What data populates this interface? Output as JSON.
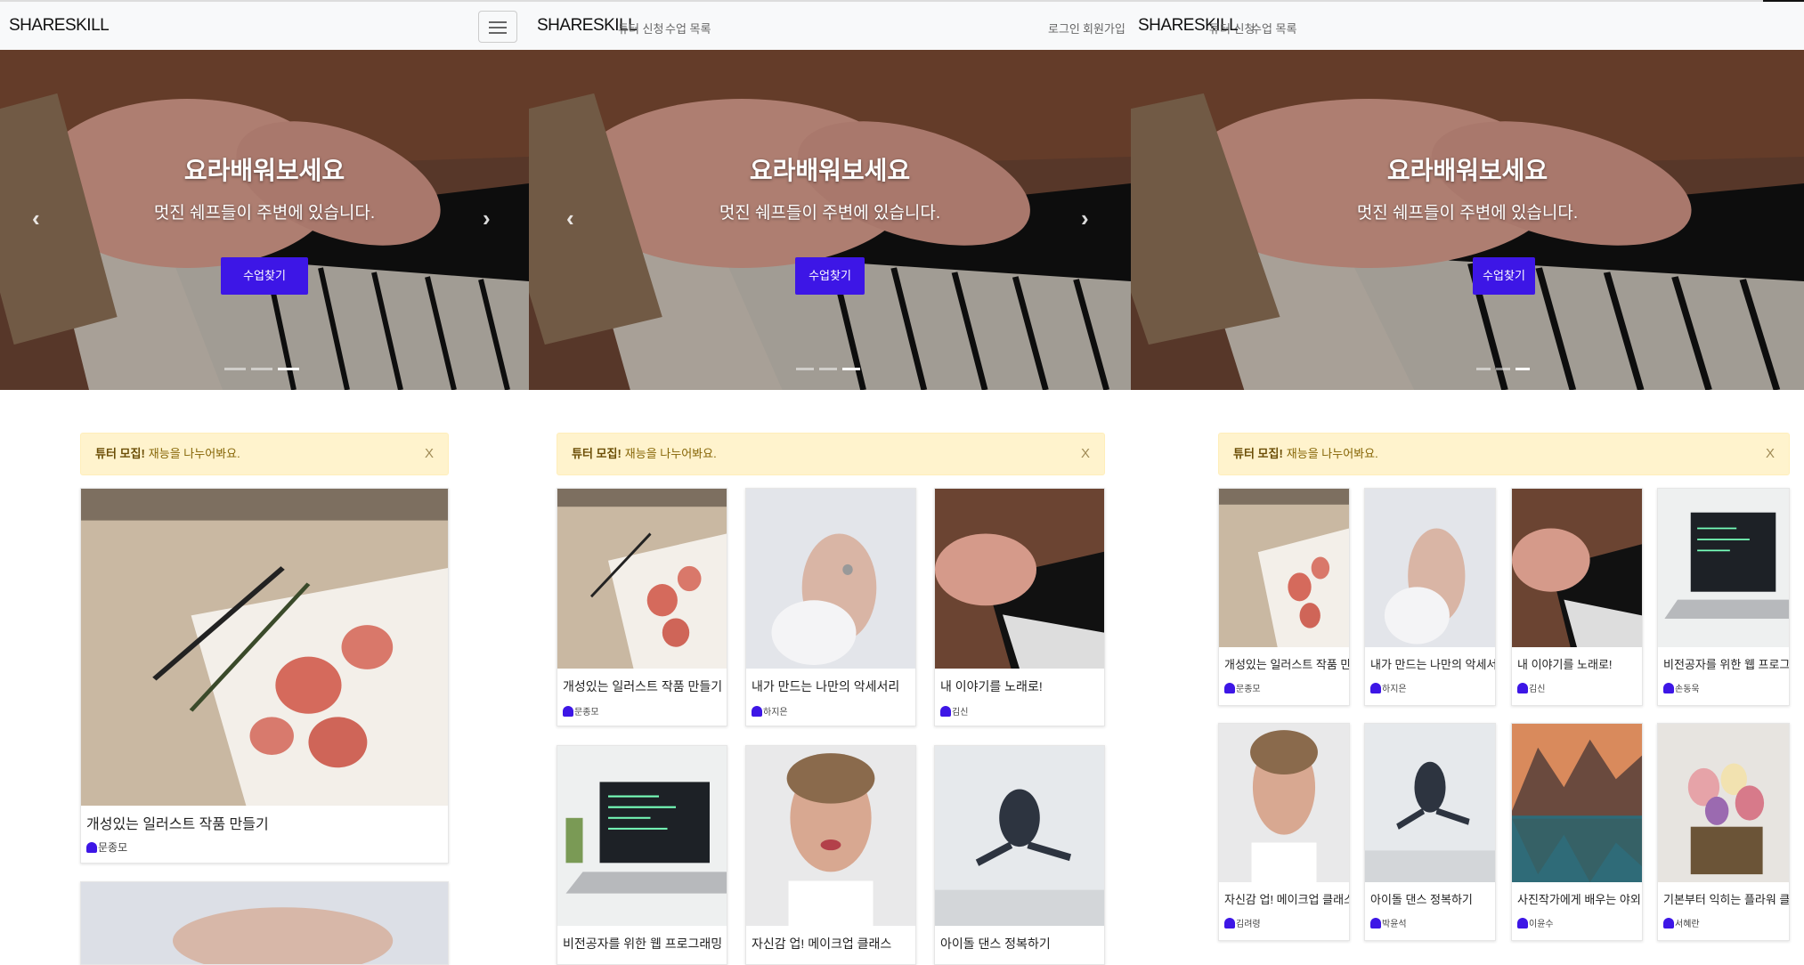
{
  "nav": {
    "brand": "SHARESKILL",
    "links": [
      "튜터 신청",
      "수업 목록"
    ],
    "auth": [
      "로그인",
      "회원가입"
    ]
  },
  "hero": {
    "title": "요라배워보세요",
    "subtitle": "멋진 쉐프들이 주변에 있습니다.",
    "button": "수업찾기",
    "slide_count": 3,
    "active_slide": 3
  },
  "alert": {
    "strong": "튜터 모집!",
    "text": "재능을 나누어봐요.",
    "close": "X"
  },
  "classes": [
    {
      "title": "개성있는 일러스트 작품 만들기",
      "tutor": "문종모",
      "image": "watercolor-flowers"
    },
    {
      "title": "내가 만드는 나만의 악세서리",
      "tutor": "하지은",
      "image": "hands-rings"
    },
    {
      "title": "내 이야기를 노래로!",
      "tutor": "김신",
      "image": "piano-hands"
    },
    {
      "title": "비전공자를 위한 웹 프로그래밍",
      "tutor": "손동욱",
      "image": "laptop-code"
    },
    {
      "title": "자신감 업! 메이크업 클래스",
      "tutor": "김려령",
      "image": "makeup-portrait"
    },
    {
      "title": "아이돌 댄스 정복하기",
      "tutor": "박윤석",
      "image": "dancer-jump"
    },
    {
      "title": "사진작가에게 배우는 야외 사진",
      "tutor": "이윤수",
      "image": "mountain-lake"
    },
    {
      "title": "기본부터 익히는 플라워 클래스",
      "tutor": "서혜란",
      "image": "flower-basket"
    }
  ],
  "colors": {
    "accent": "#3d16e6",
    "alert_bg": "#fff3cd",
    "alert_text": "#856404"
  }
}
